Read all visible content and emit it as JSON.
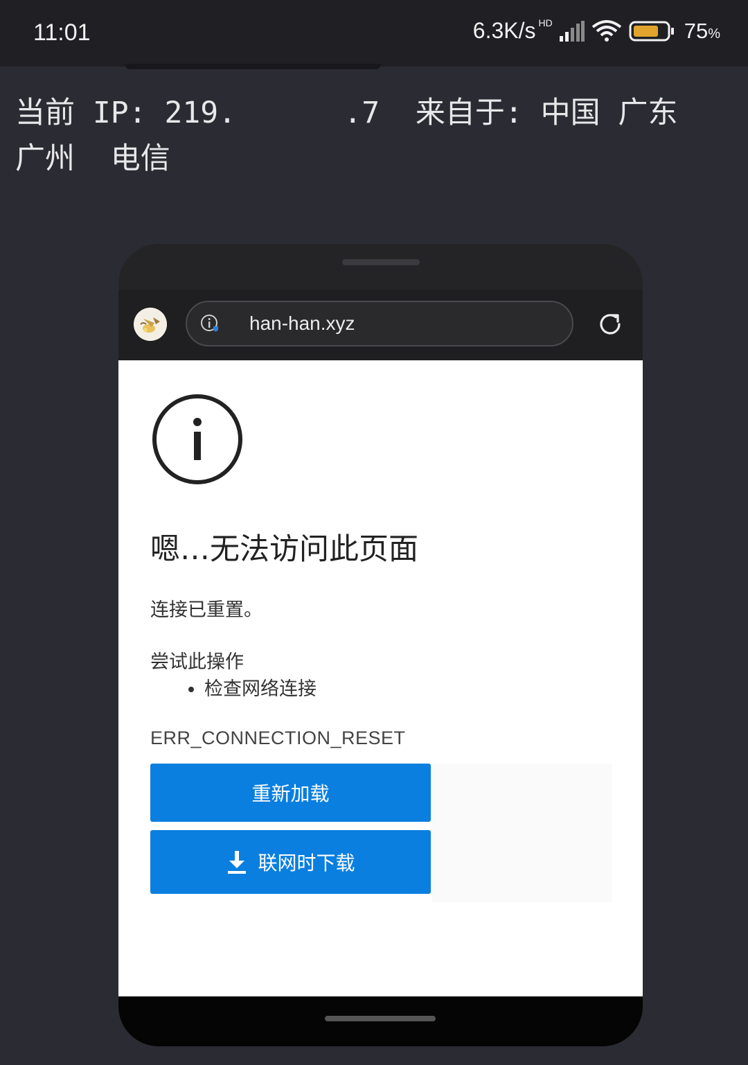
{
  "status_bar": {
    "time": "11:01",
    "net_speed": "6.3K/s",
    "hd_label": "HD",
    "battery_percent": "75",
    "battery_unit": "%",
    "battery_level": 0.75
  },
  "ip_info": {
    "line1_prefix": "当前 IP: 219.",
    "line1_masked": "1█   █",
    "line1_suffix": ".7  来自于: 中国 广东",
    "line2": "广州  电信"
  },
  "browser": {
    "url": "han-han.xyz"
  },
  "error_page": {
    "title": "嗯…无法访问此页面",
    "description": "连接已重置。",
    "try_title": "尝试此操作",
    "suggestions": [
      "检查网络连接"
    ],
    "error_code": "ERR_CONNECTION_RESET",
    "reload_button": "重新加载",
    "download_button": "联网时下载"
  },
  "colors": {
    "background": "#2b2b33",
    "button_blue": "#0a7fdf"
  }
}
